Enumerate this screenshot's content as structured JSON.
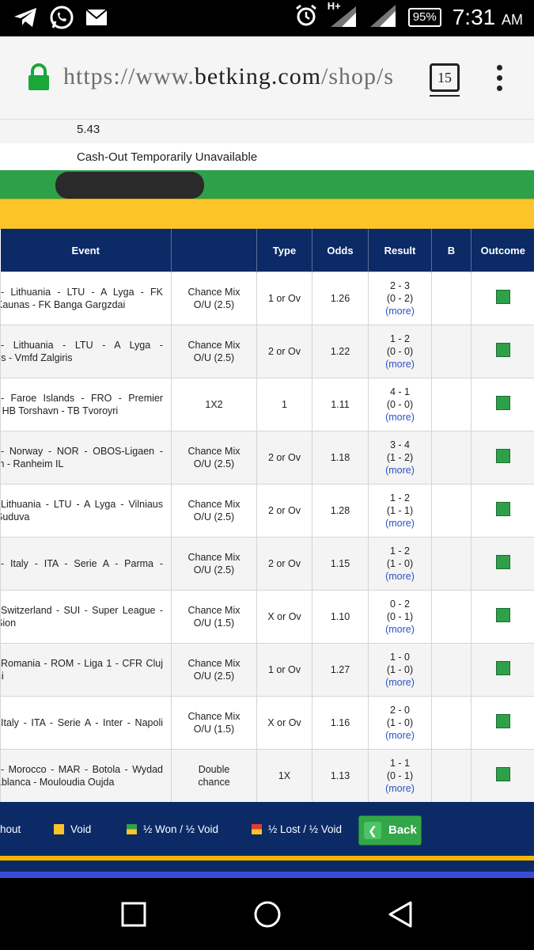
{
  "status_bar": {
    "battery": "95%",
    "time": "7:31",
    "ampm": "AM",
    "network": "H+"
  },
  "browser": {
    "url_prefix": "https://www.",
    "url_domain": "betking.com",
    "url_suffix": "/shop/s",
    "tab_count": "15"
  },
  "ticket": {
    "total_odds": "5.43",
    "cashout_text": "Cash-Out Temporarily Unavailable"
  },
  "table": {
    "headers": {
      "event": "Event",
      "market": "",
      "type": "Type",
      "odds": "Odds",
      "result": "Result",
      "b": "B",
      "outcome": "Outcome"
    },
    "more_label": "(more)",
    "rows": [
      {
        "event_l1": "- Lithuania - LTU - A Lyga - FK",
        "event_l2": "Kaunas - FK Banga Gargzdai",
        "market_l1": "Chance Mix",
        "market_l2": "O/U (2.5)",
        "type": "1 or Ov",
        "odds": "1.26",
        "ft": "2 - 3",
        "ht": "(0 - 2)"
      },
      {
        "event_l1": "- Lithuania - LTU - A Lyga -",
        "event_l2": "ys - Vmfd Zalgiris",
        "market_l1": "Chance Mix",
        "market_l2": "O/U (2.5)",
        "type": "2 or Ov",
        "odds": "1.22",
        "ft": "1 - 2",
        "ht": "(0 - 0)"
      },
      {
        "event_l1": "- Faroe Islands - FRO - Premier",
        "event_l2": "- HB Torshavn - TB Tvoroyri",
        "market_l1": "1X2",
        "market_l2": "",
        "type": "1",
        "odds": "1.11",
        "ft": "4 - 1",
        "ht": "(0 - 0)"
      },
      {
        "event_l1": "- Norway - NOR - OBOS-Ligaen -",
        "event_l2": "m - Ranheim IL",
        "market_l1": "Chance Mix",
        "market_l2": "O/U (2.5)",
        "type": "2 or Ov",
        "odds": "1.18",
        "ft": "3 - 4",
        "ht": "(1 - 2)"
      },
      {
        "event_l1": "Lithuania - LTU - A Lyga - Vilniaus",
        "event_l2": "Suduva",
        "market_l1": "Chance Mix",
        "market_l2": "O/U (2.5)",
        "type": "2 or Ov",
        "odds": "1.28",
        "ft": "1 - 2",
        "ht": "(1 - 1)"
      },
      {
        "event_l1": "- Italy - ITA - Serie A - Parma -",
        "event_l2": "",
        "market_l1": "Chance Mix",
        "market_l2": "O/U (2.5)",
        "type": "2 or Ov",
        "odds": "1.15",
        "ft": "1 - 2",
        "ht": "(1 - 0)"
      },
      {
        "event_l1": "Switzerland - SUI - Super League -",
        "event_l2": "Sion",
        "market_l1": "Chance Mix",
        "market_l2": "O/U (1.5)",
        "type": "X or Ov",
        "odds": "1.10",
        "ft": "0 - 2",
        "ht": "(0 - 1)"
      },
      {
        "event_l1": "Romania - ROM - Liga 1 - CFR Cluj",
        "event_l2": "ni",
        "market_l1": "Chance Mix",
        "market_l2": "O/U (2.5)",
        "type": "1 or Ov",
        "odds": "1.27",
        "ft": "1 - 0",
        "ht": "(1 - 0)"
      },
      {
        "event_l1": "Italy - ITA - Serie A - Inter - Napoli",
        "event_l2": "",
        "market_l1": "Chance Mix",
        "market_l2": "O/U (1.5)",
        "type": "X or Ov",
        "odds": "1.16",
        "ft": "2 - 0",
        "ht": "(1 - 0)"
      },
      {
        "event_l1": "- Morocco - MAR - Botola - Wydad",
        "event_l2": "ablanca - Mouloudia Oujda",
        "market_l1": "Double",
        "market_l2": "chance",
        "type": "1X",
        "odds": "1.13",
        "ft": "1 - 1",
        "ht": "(0 - 1)"
      }
    ]
  },
  "legend": {
    "cashout": "hout",
    "void": "Void",
    "half_won": "½ Won / ½ Void",
    "half_lost": "½ Lost / ½ Void",
    "back": "Back"
  },
  "colors": {
    "navy": "#0b2a66",
    "green": "#2fa04a",
    "yellow": "#fbc52a",
    "link": "#2b52c7"
  }
}
